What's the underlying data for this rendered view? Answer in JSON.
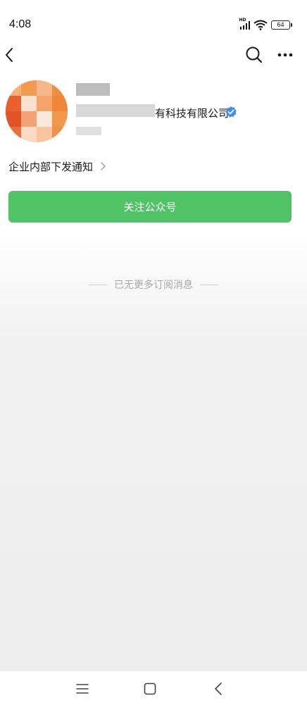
{
  "status_bar": {
    "time": "4:08",
    "network": "HD",
    "battery": "64"
  },
  "profile": {
    "company_name_visible": "有科技有限公司",
    "verified": true
  },
  "notice": {
    "label": "企业内部下发通知"
  },
  "actions": {
    "follow_label": "关注公众号"
  },
  "feed": {
    "end_text": "已无更多订阅消息"
  },
  "colors": {
    "accent_green": "#4fc365",
    "verified_blue": "#3d8ef0",
    "avatar_orange": "#ee8a3c"
  },
  "icons": {
    "nav_back": "back-arrow-icon",
    "nav_search": "search-icon",
    "nav_more": "more-icon",
    "verified": "verified-badge-icon",
    "chevron": "chevron-right-icon",
    "sys_menu": "menu-icon",
    "sys_home": "home-icon",
    "sys_back": "back-icon"
  }
}
